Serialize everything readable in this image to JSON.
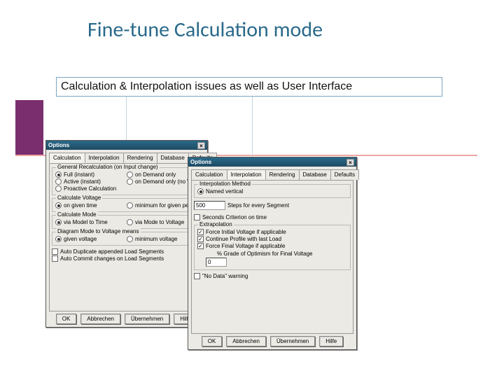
{
  "slide": {
    "title": "Fine-tune Calculation mode",
    "subtitle": "Calculation & Interpolation issues as well as User Interface"
  },
  "win1": {
    "title": "Options",
    "tabs": [
      "Calculation",
      "Interpolation",
      "Rendering",
      "Database",
      "Defaults"
    ],
    "activeTab": 0,
    "grp_recalc": {
      "legend": "General Recalculation (on Input change)",
      "opts": [
        "Full (instant)",
        "Active (instant)",
        "Proactive Calculation",
        "on Demand only",
        "on Demand only (no War"
      ]
    },
    "grp_volt": {
      "legend": "Calculate Voltage",
      "opts": [
        "on given time",
        "minimum for given period"
      ]
    },
    "grp_mode": {
      "legend": "Calculate Mode",
      "opts": [
        "via Model to Time",
        "via Mode to Voltage"
      ]
    },
    "grp_diag": {
      "legend": "Diagram Mode to Voltage means",
      "opts": [
        "given voltage",
        "minimum voltage"
      ]
    },
    "chk_dup": "Auto Duplicate appended Load Segments",
    "chk_com": "Auto Commit changes on Load Segments"
  },
  "win2": {
    "title": "Options",
    "tabs": [
      "Calculation",
      "Interpolation",
      "Rendering",
      "Database",
      "Defaults"
    ],
    "activeTab": 1,
    "grp_method": {
      "legend": "Interpolation Method",
      "opt": "Named vertical"
    },
    "steps_val": "500",
    "steps_lbl": "Steps for every Segment",
    "chk_sec": "Seconds Criterion on time",
    "grp_extra": {
      "legend": "Extrapolation",
      "chk1": "Force Initial Voltage if applicable",
      "chk2": "Continue Profile with last Load",
      "chk3": "Force Final Voltage if applicable",
      "pct_lbl": "% Grade of Optimism for Final Voltage",
      "pct_val": "0"
    },
    "chk_nodata": "\"No Data\" warning"
  },
  "buttons": {
    "ok": "OK",
    "cancel": "Abbrechen",
    "apply": "Übernehmen",
    "help": "Hilfe"
  }
}
